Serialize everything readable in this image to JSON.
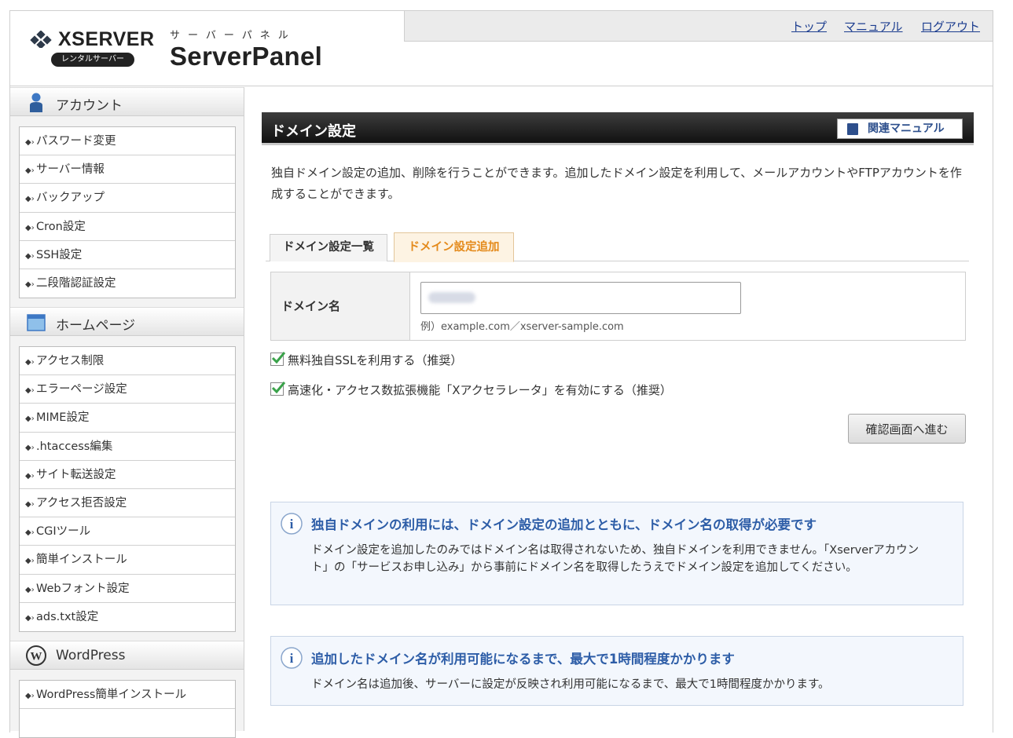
{
  "header": {
    "brand": "XSERVER",
    "brand_sub": "レンタルサーバー",
    "panel_kana": "サーバーパネル",
    "panel_name": "ServerPanel",
    "nav": {
      "top": "トップ",
      "manual": "マニュアル",
      "logout": "ログアウト"
    }
  },
  "sidebar": {
    "sections": [
      {
        "title": "アカウント",
        "icon": "person-icon",
        "items": [
          "パスワード変更",
          "サーバー情報",
          "バックアップ",
          "Cron設定",
          "SSH設定",
          "二段階認証設定"
        ]
      },
      {
        "title": "ホームページ",
        "icon": "webpage-icon",
        "items": [
          "アクセス制限",
          "エラーページ設定",
          "MIME設定",
          ".htaccess編集",
          "サイト転送設定",
          "アクセス拒否設定",
          "CGIツール",
          "簡単インストール",
          "Webフォント設定",
          "ads.txt設定"
        ]
      },
      {
        "title": "WordPress",
        "icon": "wordpress-icon",
        "items": [
          "WordPress簡単インストール"
        ]
      }
    ]
  },
  "main": {
    "title": "ドメイン設定",
    "manual_button": "関連マニュアル",
    "description": "独自ドメイン設定の追加、削除を行うことができます。追加したドメイン設定を利用して、メールアカウントやFTPアカウントを作成することができます。",
    "tabs": [
      {
        "label": "ドメイン設定一覧",
        "active": false
      },
      {
        "label": "ドメイン設定追加",
        "active": true
      }
    ],
    "form": {
      "domain_label": "ドメイン名",
      "domain_value": "",
      "domain_hint": "例）example.com／xserver-sample.com"
    },
    "options": [
      {
        "label": "無料独自SSLを利用する（推奨）",
        "checked": true
      },
      {
        "label": "高速化・アクセス数拡張機能「Xアクセラレータ」を有効にする（推奨）",
        "checked": true
      }
    ],
    "confirm_button": "確認画面へ進む",
    "notices": [
      {
        "heading": "独自ドメインの利用には、ドメイン設定の追加とともに、ドメイン名の取得が必要です",
        "body": "ドメイン設定を追加したのみではドメイン名は取得されないため、独自ドメインを利用できません。「Xserverアカウント」の「サービスお申し込み」から事前にドメイン名を取得したうえでドメイン設定を追加してください。"
      },
      {
        "heading": "追加したドメイン名が利用可能になるまで、最大で1時間程度かかります",
        "body": "ドメイン名は追加後、サーバーに設定が反映され利用可能になるまで、最大で1時間程度かかります。"
      }
    ]
  },
  "colors": {
    "link": "#1c3d8f",
    "accent_tab": "#e48a1b",
    "check": "#3aa24a",
    "notice_heading": "#2d5da7"
  }
}
